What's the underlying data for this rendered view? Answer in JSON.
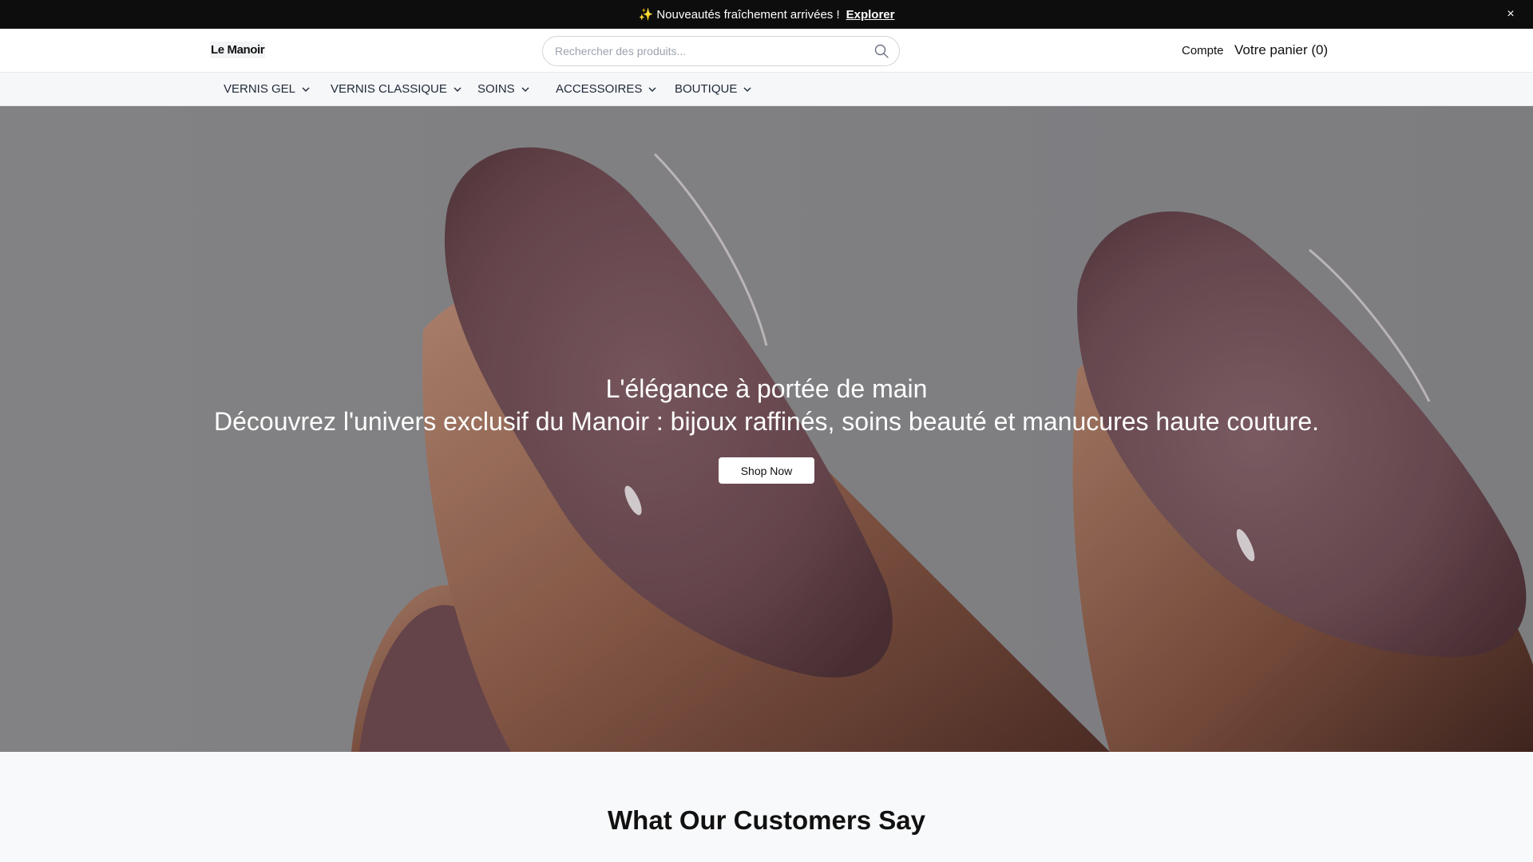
{
  "announcement": {
    "text": "✨ Nouveautés fraîchement arrivées !",
    "link": "Explorer",
    "close_icon": "×"
  },
  "header": {
    "logo": "Le Manoir",
    "search_placeholder": "Rechercher des produits...",
    "search_icon": "search-icon",
    "account": "Compte",
    "cart": "Votre panier (0)"
  },
  "nav": {
    "items": [
      {
        "label": "VERNIS GEL"
      },
      {
        "label": "VERNIS CLASSIQUE"
      },
      {
        "label": "SOINS"
      },
      {
        "label": "ACCESSOIRES"
      },
      {
        "label": "BOUTIQUE"
      }
    ],
    "dropdown_icon": "chevron-down-icon"
  },
  "hero": {
    "title": "L'élégance à portée de main",
    "subtitle": "Découvrez l'univers exclusif du Manoir : bijoux raffinés, soins beauté et manucures haute couture.",
    "cta": "Shop Now"
  },
  "reviews": {
    "title": "What Our Customers Say"
  },
  "colors": {
    "announcement_bg": "#0d0d0d",
    "nav_bg": "#f6f7f9",
    "hero_bg": "#8a8a8c",
    "nail_color": "#7a5156"
  }
}
